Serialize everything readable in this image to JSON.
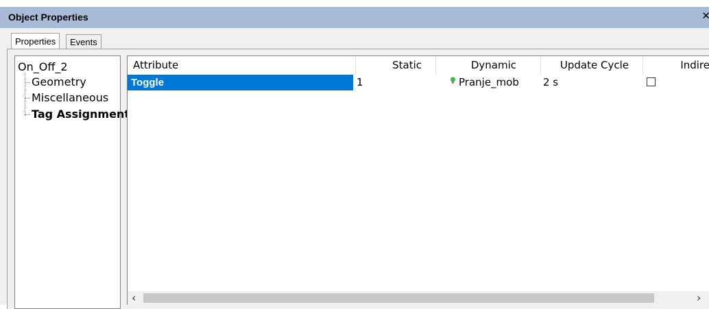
{
  "window": {
    "title": "Object Properties",
    "close_glyph": "✕"
  },
  "tabs": [
    {
      "label": "Properties",
      "active": true
    },
    {
      "label": "Events",
      "active": false
    }
  ],
  "tree": {
    "root": "On_Off_2",
    "children": [
      "Geometry",
      "Miscellaneous",
      "Tag Assignment"
    ],
    "selected": "Tag Assignment"
  },
  "grid": {
    "columns": [
      "Attribute",
      "Static",
      "Dynamic",
      "Update Cycle",
      "Indire"
    ],
    "rows": [
      {
        "attribute": "Toggle",
        "static": "1",
        "dynamic": "Pranje_mob",
        "dynamic_icon": "lightbulb-icon",
        "update_cycle": "2 s",
        "indirect": false
      }
    ]
  },
  "scrollbar": {
    "left_arrow": "‹",
    "right_arrow": "›"
  },
  "colors": {
    "selection": "#0078d7",
    "titlebar": "#aabbd8",
    "bulb": "#3cc13c"
  }
}
